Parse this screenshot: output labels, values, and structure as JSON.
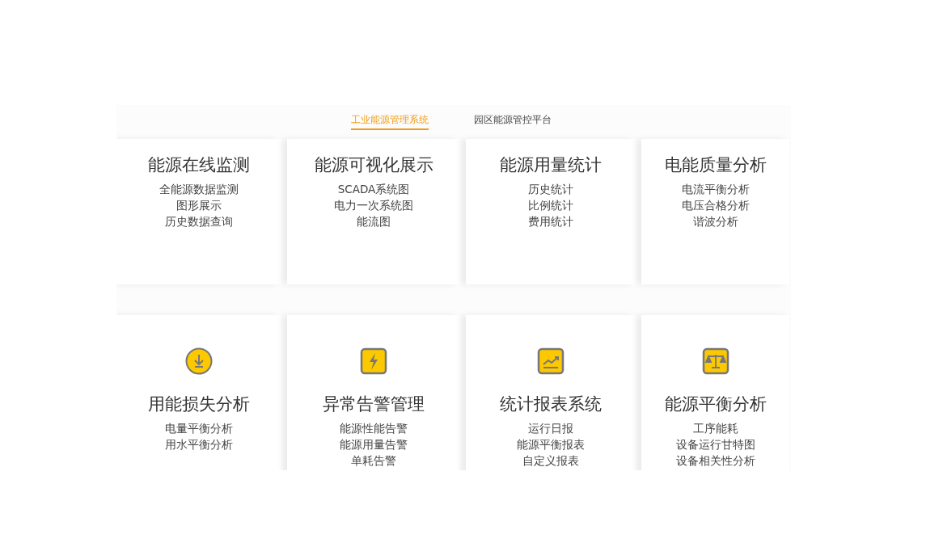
{
  "tabs": [
    {
      "label": "工业能源管理系统",
      "selected": true
    },
    {
      "label": "园区能源管控平台",
      "selected": false
    }
  ],
  "top_cards": [
    {
      "title": "能源在线监测",
      "items": [
        "全能源数据监测",
        "图形展示",
        "历史数据查询"
      ]
    },
    {
      "title": "能源可视化展示",
      "items": [
        "SCADA系统图",
        "电力一次系统图",
        "能流图"
      ]
    },
    {
      "title": "能源用量统计",
      "items": [
        "历史统计",
        "比例统计",
        "费用统计"
      ]
    },
    {
      "title": "电能质量分析",
      "items": [
        "电流平衡分析",
        "电压合格分析",
        "谐波分析"
      ]
    }
  ],
  "bottom_cards": [
    {
      "title": "用能损失分析",
      "items": [
        "电量平衡分析",
        "用水平衡分析"
      ]
    },
    {
      "title": "异常告警管理",
      "items": [
        "能源性能告警",
        "能源用量告警",
        "单耗告警"
      ]
    },
    {
      "title": "统计报表系统",
      "items": [
        "运行日报",
        "能源平衡报表",
        "自定义报表"
      ]
    },
    {
      "title": "能源平衡分析",
      "items": [
        "工序能耗",
        "设备运行甘特图",
        "设备相关性分析"
      ]
    }
  ]
}
